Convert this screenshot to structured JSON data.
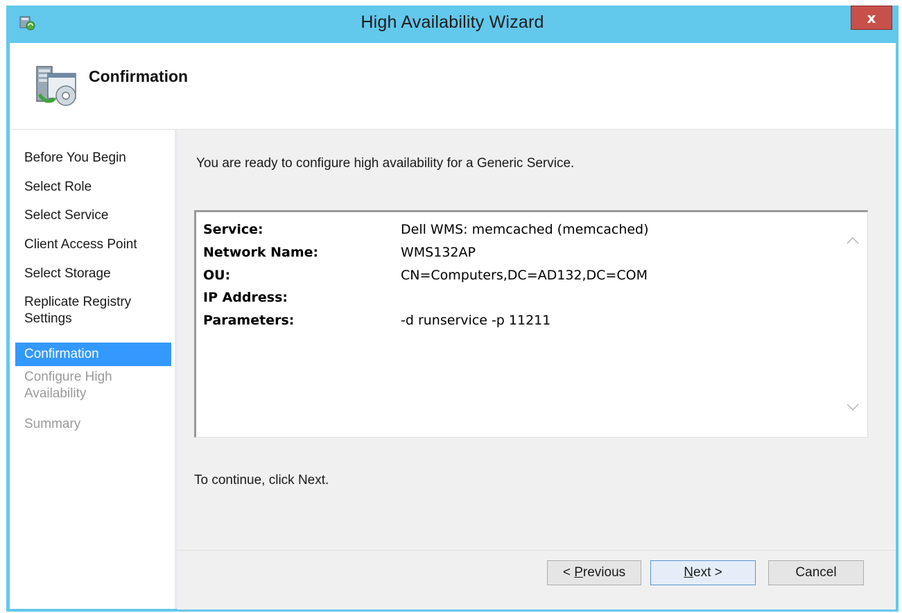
{
  "window": {
    "title": "High Availability Wizard",
    "close_label": "x"
  },
  "header": {
    "title": "Confirmation"
  },
  "sidebar": {
    "steps": [
      {
        "label": "Before You Begin",
        "state": "normal"
      },
      {
        "label": "Select Role",
        "state": "normal"
      },
      {
        "label": "Select Service",
        "state": "normal"
      },
      {
        "label": "Client Access Point",
        "state": "normal"
      },
      {
        "label": "Select Storage",
        "state": "normal"
      },
      {
        "label": "Replicate Registry Settings",
        "line1": "Replicate Registry",
        "line2": "Settings",
        "state": "normal"
      },
      {
        "label": "Confirmation",
        "state": "active"
      },
      {
        "label": "Configure High Availability",
        "line1": "Configure High",
        "line2": "Availability",
        "state": "disabled"
      },
      {
        "label": "Summary",
        "state": "disabled"
      }
    ]
  },
  "main": {
    "intro": "You are ready to configure high availability for a Generic Service.",
    "details": [
      {
        "label": "Service:",
        "value": "Dell WMS: memcached (memcached)"
      },
      {
        "label": "Network Name:",
        "value": "WMS132AP"
      },
      {
        "label": "OU:",
        "value": "CN=Computers,DC=AD132,DC=COM"
      },
      {
        "label": "IP Address:",
        "value": ""
      },
      {
        "label": "Parameters:",
        "value": "-d runservice -p 11211"
      }
    ],
    "footer_text": "To continue, click Next."
  },
  "buttons": {
    "previous": {
      "prefix": "< ",
      "accel": "P",
      "rest": "revious"
    },
    "next": {
      "accel": "N",
      "rest": "ext >"
    },
    "cancel": "Cancel"
  },
  "colors": {
    "title_bar": "#62c8ec",
    "close_button": "#c7504a",
    "selected_step": "#3399ff",
    "disabled_step": "#9a9a9a"
  }
}
